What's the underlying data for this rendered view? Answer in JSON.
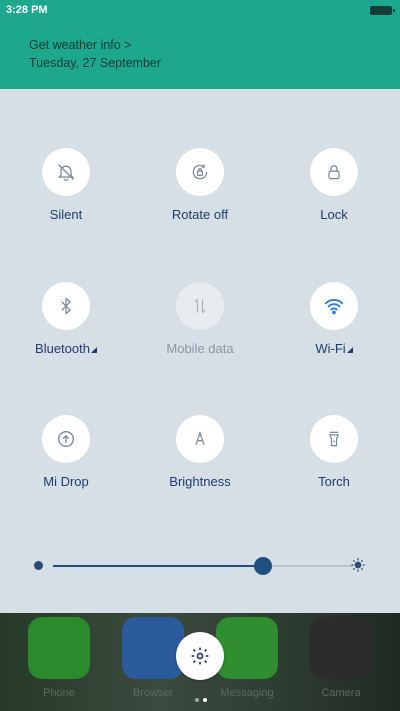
{
  "status_bar": {
    "time": "3:28 PM"
  },
  "header": {
    "weather_link": "Get weather info >",
    "date": "Tuesday, 27 September"
  },
  "toggles": [
    {
      "label": "Silent",
      "icon": "bell-off-icon",
      "state": "off"
    },
    {
      "label": "Rotate off",
      "icon": "rotation-lock-icon",
      "state": "off"
    },
    {
      "label": "Lock",
      "icon": "lock-icon",
      "state": "off"
    },
    {
      "label": "Bluetooth",
      "icon": "bluetooth-icon",
      "state": "off",
      "has_menu": true
    },
    {
      "label": "Mobile data",
      "icon": "mobile-data-icon",
      "state": "disabled"
    },
    {
      "label": "Wi-Fi",
      "icon": "wifi-icon",
      "state": "on",
      "has_menu": true
    },
    {
      "label": "Mi Drop",
      "icon": "mi-drop-icon",
      "state": "off"
    },
    {
      "label": "Brightness",
      "icon": "brightness-auto-icon",
      "state": "off"
    },
    {
      "label": "Torch",
      "icon": "torch-icon",
      "state": "off"
    }
  ],
  "brightness_slider": {
    "value_fraction": 0.7
  },
  "dock": {
    "apps": [
      {
        "label": "Phone",
        "icon": "phone-icon"
      },
      {
        "label": "Browser",
        "icon": "compass-icon"
      },
      {
        "label": "Messaging",
        "icon": "message-icon"
      },
      {
        "label": "Camera",
        "icon": "camera-icon"
      }
    ]
  },
  "settings_button": {
    "icon": "gear-icon"
  },
  "pager": {
    "pages": 2,
    "active": 2
  },
  "colors": {
    "accent": "#1da88e",
    "panel": "#d5dfe5",
    "text": "#1f3c6c",
    "active_icon": "#2a7be4"
  }
}
